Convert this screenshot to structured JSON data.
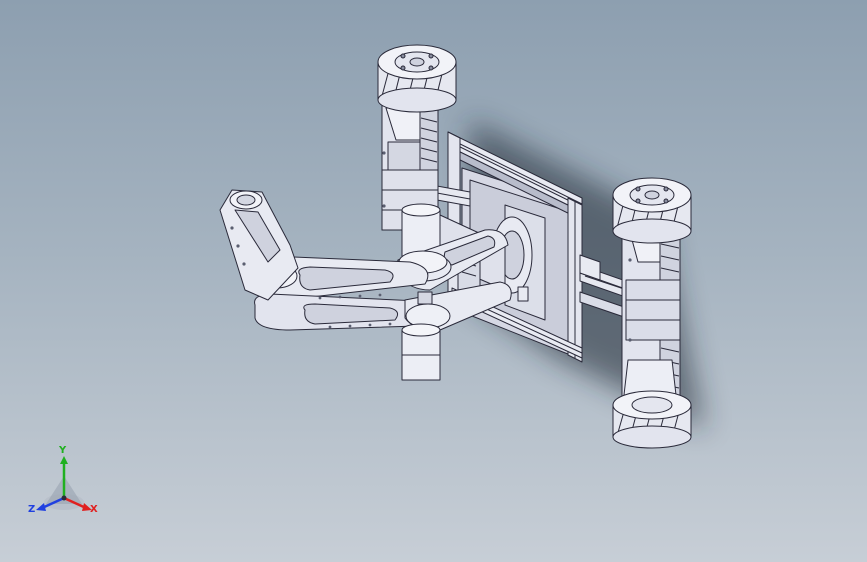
{
  "view": {
    "background_top": "#8d9fb0",
    "background_bottom": "#c7ced6"
  },
  "model": {
    "part_color": "#e2e4ee",
    "edge_color": "#2a2a3a",
    "shadow_color": "#1e2530"
  },
  "triad": {
    "x_label": "X",
    "y_label": "Y",
    "z_label": "Z",
    "x_color": "#e02020",
    "y_color": "#20b020",
    "z_color": "#2040e0"
  }
}
